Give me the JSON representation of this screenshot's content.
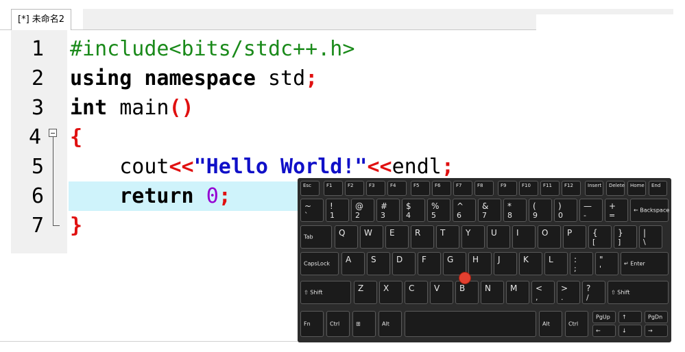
{
  "tab": {
    "title": "[*] 未命名2"
  },
  "editor": {
    "lines": [
      {
        "num": "1"
      },
      {
        "num": "2"
      },
      {
        "num": "3"
      },
      {
        "num": "4"
      },
      {
        "num": "5"
      },
      {
        "num": "6"
      },
      {
        "num": "7"
      }
    ],
    "code": {
      "l1": "#include<bits/stdc++.h>",
      "l2_kw1": "using",
      "l2_kw2": "namespace",
      "l2_id": " std",
      "l2_semi": ";",
      "l3_kw": "int",
      "l3_id": " main",
      "l3_paren": "()",
      "l4_brace": "{",
      "l5_id": "    cout",
      "l5_op1": "<<",
      "l5_str": "\"Hello World!\"",
      "l5_op2": "<<",
      "l5_id2": "endl",
      "l5_semi": ";",
      "l6_kw": "    return",
      "l6_num": "0",
      "l6_semi": ";",
      "l7_brace": "}"
    },
    "current_line": 6
  },
  "keyboard": {
    "row_fn": [
      "Esc",
      "F1",
      "F2",
      "F3",
      "F4",
      "F5",
      "F6",
      "F7",
      "F8",
      "F9",
      "F10",
      "F11",
      "F12",
      "Insert",
      "Delete",
      "Home",
      "End"
    ],
    "row_num": [
      {
        "t": "~",
        "b": "`"
      },
      {
        "t": "!",
        "b": "1"
      },
      {
        "t": "@",
        "b": "2"
      },
      {
        "t": "#",
        "b": "3"
      },
      {
        "t": "$",
        "b": "4"
      },
      {
        "t": "%",
        "b": "5"
      },
      {
        "t": "^",
        "b": "6"
      },
      {
        "t": "&",
        "b": "7"
      },
      {
        "t": "*",
        "b": "8"
      },
      {
        "t": "(",
        "b": "9"
      },
      {
        "t": ")",
        "b": "0"
      },
      {
        "t": "—",
        "b": "-"
      },
      {
        "t": "+",
        "b": "="
      }
    ],
    "backspace": "Backspace",
    "tab": "Tab",
    "row_q": [
      "Q",
      "W",
      "E",
      "R",
      "T",
      "Y",
      "U",
      "I",
      "O",
      "P"
    ],
    "row_q_sym": [
      {
        "t": "{",
        "b": "["
      },
      {
        "t": "}",
        "b": "]"
      },
      {
        "t": "|",
        "b": "\\"
      }
    ],
    "capslock": "CapsLock",
    "row_a": [
      "A",
      "S",
      "D",
      "F",
      "G",
      "H",
      "J",
      "K",
      "L"
    ],
    "row_a_sym": [
      {
        "t": ":",
        "b": ";"
      },
      {
        "t": "\"",
        "b": "'"
      }
    ],
    "enter": "Enter",
    "shift_l": "Shift",
    "row_z": [
      "Z",
      "X",
      "C",
      "V",
      "B",
      "N",
      "M"
    ],
    "row_z_sym": [
      {
        "t": "<",
        "b": ","
      },
      {
        "t": ">",
        "b": "."
      },
      {
        "t": "?",
        "b": "/"
      }
    ],
    "shift_r": "Shift",
    "bottom": {
      "fn": "Fn",
      "ctrl": "Ctrl",
      "alt": "Alt",
      "alt_r": "Alt",
      "ctrl_r": "Ctrl",
      "pgup": "PgUp",
      "pgdn": "PgDn"
    },
    "colors": {
      "trackpoint": "#e24030",
      "keycap": "#1b1b1b",
      "fn_blue": "#6fa8ff"
    }
  }
}
